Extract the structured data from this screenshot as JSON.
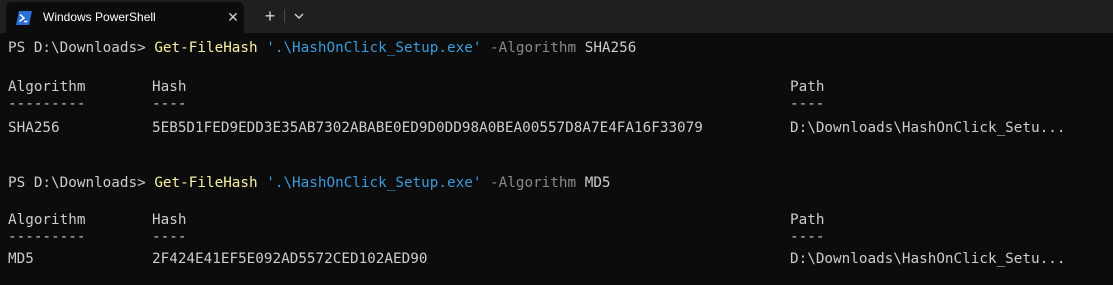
{
  "window": {
    "tab_title": "Windows PowerShell",
    "close_glyph": "✕",
    "new_tab_glyph": "+",
    "icons": [
      "powershell-icon",
      "close-icon",
      "plus-icon",
      "chevron-down-icon"
    ],
    "colors": {
      "background": "#0c0c0c",
      "titlebar": "#1f1f1f",
      "text": "#cccccc",
      "command": "#f9f1a5",
      "string": "#3b9bdc",
      "parameter": "#8a8a8a"
    }
  },
  "terminal": {
    "blocks": [
      {
        "prompt": "PS D:\\Downloads> ",
        "command": "Get-FileHash",
        "path_arg": "'.\\HashOnClick_Setup.exe'",
        "param": "-Algorithm",
        "param_value": "SHA256",
        "headers": [
          "Algorithm",
          "Hash",
          "Path"
        ],
        "dashes": [
          "---------",
          "----",
          "----"
        ],
        "row": {
          "algorithm": "SHA256",
          "hash": "5EB5D1FED9EDD3E35AB7302ABABE0ED9D0DD98A0BEA00557D8A7E4FA16F33079",
          "path": "D:\\Downloads\\HashOnClick_Setu..."
        }
      },
      {
        "prompt": "PS D:\\Downloads> ",
        "command": "Get-FileHash",
        "path_arg": "'.\\HashOnClick_Setup.exe'",
        "param": "-Algorithm",
        "param_value": "MD5",
        "headers": [
          "Algorithm",
          "Hash",
          "Path"
        ],
        "dashes": [
          "---------",
          "----",
          "----"
        ],
        "row": {
          "algorithm": "MD5",
          "hash": "2F424E41EF5E092AD5572CED102AED90",
          "path": "D:\\Downloads\\HashOnClick_Setu..."
        }
      }
    ]
  }
}
